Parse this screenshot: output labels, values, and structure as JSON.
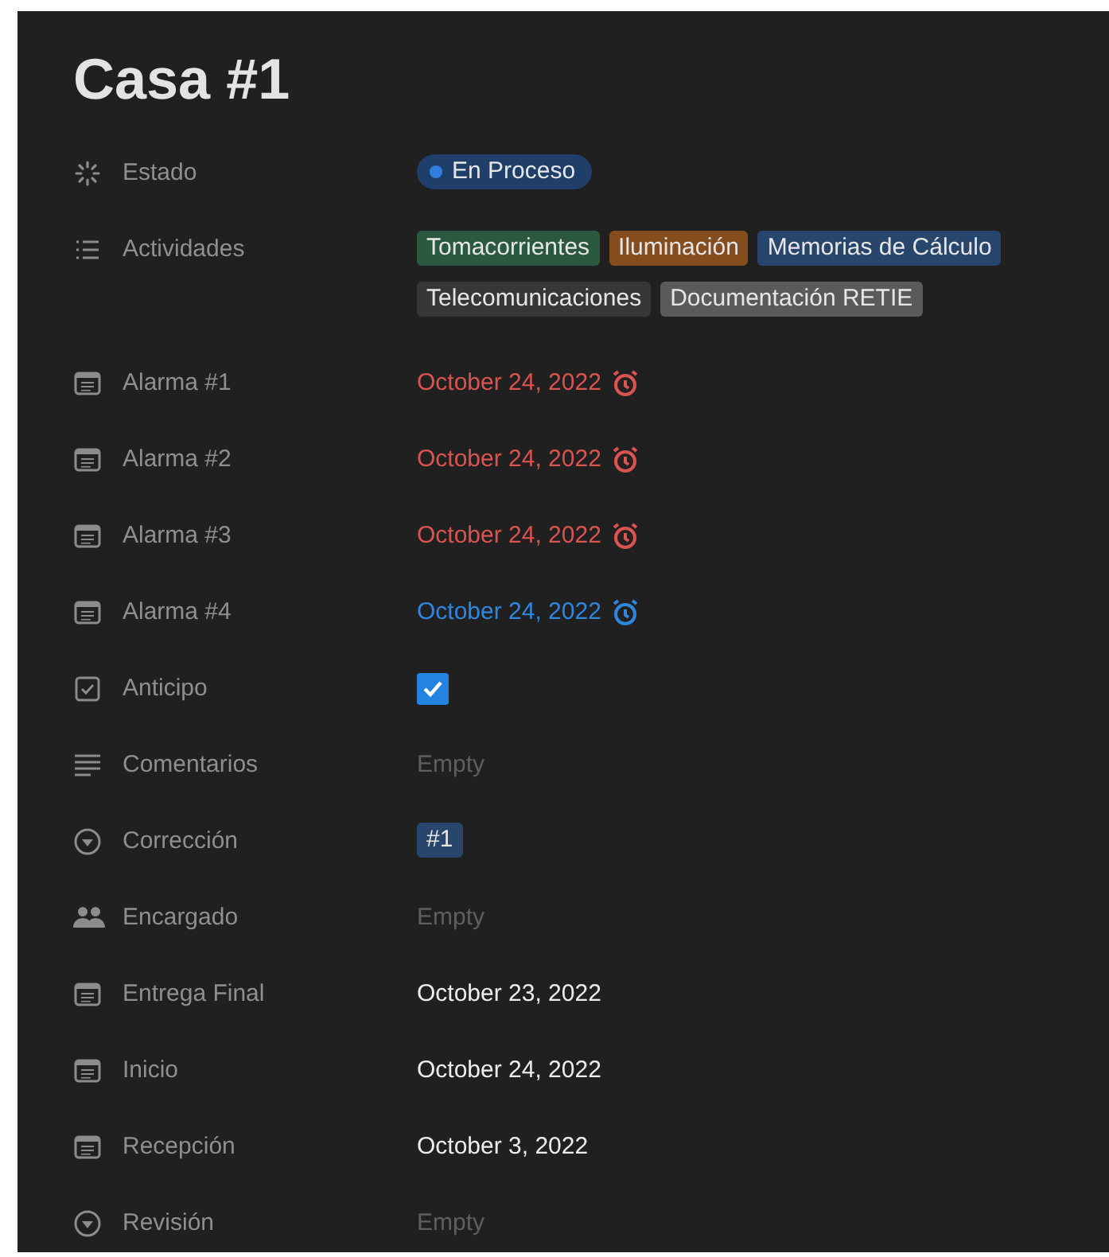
{
  "title": "Casa #1",
  "properties": [
    {
      "kind": "status",
      "label": "Estado",
      "value": {
        "text": "En Proceso",
        "color": "#2e7fdb"
      }
    },
    {
      "kind": "multiselect",
      "label": "Actividades",
      "tags": [
        {
          "text": "Tomacorrientes",
          "color": "#2b593f"
        },
        {
          "text": "Iluminación",
          "color": "#854c1d"
        },
        {
          "text": "Memorias de Cálculo",
          "color": "#28456c"
        },
        {
          "text": "Telecomunicaciones",
          "color": "#373737"
        },
        {
          "text": "Documentación RETIE",
          "color": "#5a5a5a"
        }
      ]
    },
    {
      "kind": "date",
      "label": "Alarma #1",
      "value": "October 24, 2022",
      "reminder": true,
      "overdue": true
    },
    {
      "kind": "date",
      "label": "Alarma #2",
      "value": "October 24, 2022",
      "reminder": true,
      "overdue": true
    },
    {
      "kind": "date",
      "label": "Alarma #3",
      "value": "October 24, 2022",
      "reminder": true,
      "overdue": true
    },
    {
      "kind": "date",
      "label": "Alarma #4",
      "value": "October 24, 2022",
      "reminder": true,
      "overdue": false
    },
    {
      "kind": "checkbox",
      "label": "Anticipo",
      "checked": true
    },
    {
      "kind": "text",
      "label": "Comentarios",
      "placeholder": "Empty"
    },
    {
      "kind": "select",
      "label": "Corrección",
      "tags": [
        {
          "text": "#1",
          "color": "#28456c"
        }
      ]
    },
    {
      "kind": "person",
      "label": "Encargado",
      "placeholder": "Empty"
    },
    {
      "kind": "date",
      "label": "Entrega Final",
      "value": "October 23, 2022"
    },
    {
      "kind": "date",
      "label": "Inicio",
      "value": "October 24, 2022"
    },
    {
      "kind": "date",
      "label": "Recepción",
      "value": "October 3, 2022"
    },
    {
      "kind": "select",
      "label": "Revisión",
      "placeholder": "Empty"
    }
  ]
}
